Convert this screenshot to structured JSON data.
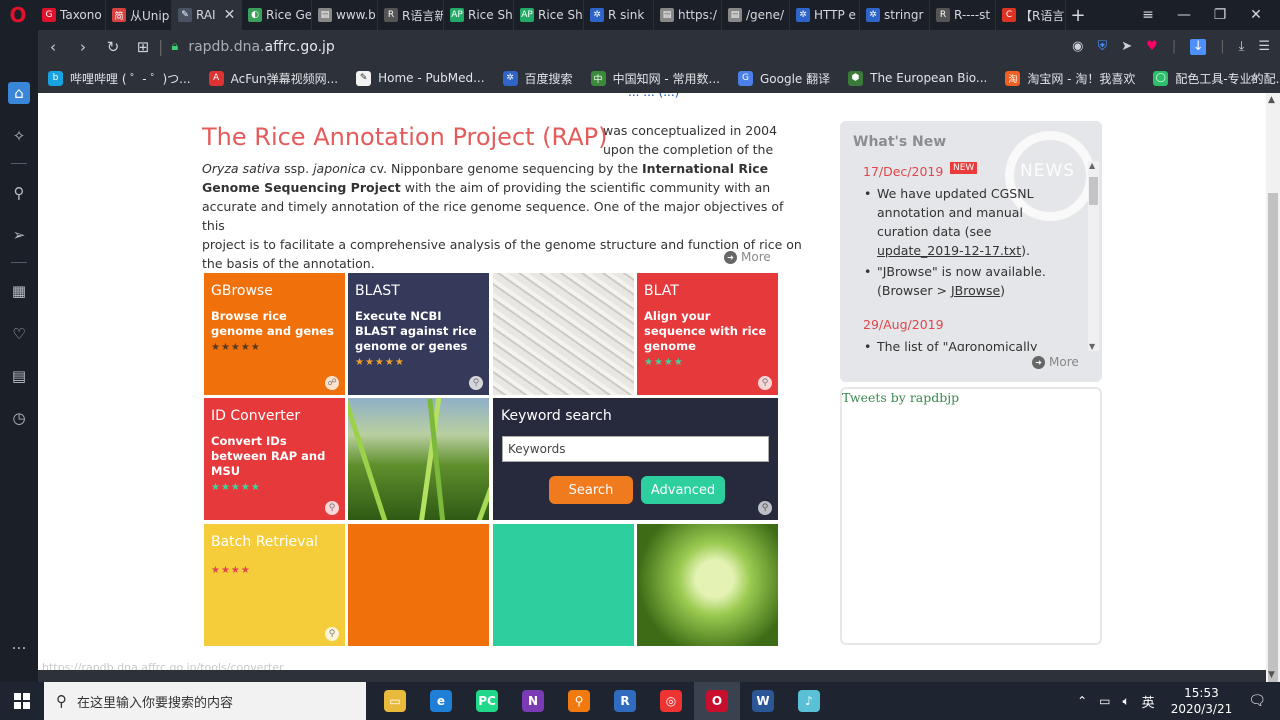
{
  "browser": {
    "tabs": [
      {
        "label": "Taxono",
        "icon": "G",
        "color": "#e0112b"
      },
      {
        "label": "从Unip",
        "icon": "简",
        "color": "#d94040"
      },
      {
        "label": "RAI",
        "icon": "✎",
        "color": "#4a5363",
        "active": true
      },
      {
        "label": "Rice Ge",
        "icon": "◐",
        "color": "#3aa05a"
      },
      {
        "label": "www.b",
        "icon": "▤",
        "color": "#888"
      },
      {
        "label": "R语言新",
        "icon": "R",
        "color": "#555"
      },
      {
        "label": "Rice Sh",
        "icon": "AP",
        "color": "#2a6"
      },
      {
        "label": "Rice Sh",
        "icon": "AP",
        "color": "#2a6"
      },
      {
        "label": "R sink",
        "icon": "✲",
        "color": "#2f64c8"
      },
      {
        "label": "https:/",
        "icon": "▤",
        "color": "#888"
      },
      {
        "label": "/gene/",
        "icon": "▤",
        "color": "#888"
      },
      {
        "label": "HTTP e",
        "icon": "✲",
        "color": "#2f64c8"
      },
      {
        "label": "stringr",
        "icon": "✲",
        "color": "#2f64c8"
      },
      {
        "label": "R----st",
        "icon": "R",
        "color": "#555"
      },
      {
        "label": "【R语言",
        "icon": "C",
        "color": "#d32"
      }
    ],
    "active_close": "✕",
    "new_tab": "+",
    "url_prefix": "rapdb.dna.",
    "url_domain": "affrc.go.jp",
    "bookmarks": [
      {
        "label": "哔哩哔哩 ( ゜- ゜)つ...",
        "color": "#19a2e0",
        "icon": "b"
      },
      {
        "label": "AcFun弹幕视频网...",
        "color": "#d33",
        "icon": "A"
      },
      {
        "label": "Home - PubMed...",
        "color": "#f2f2f2",
        "icon": "✎"
      },
      {
        "label": "百度搜索",
        "color": "#2f64c8",
        "icon": "✲"
      },
      {
        "label": "中国知网 - 常用数...",
        "color": "#3a8a3a",
        "icon": "中"
      },
      {
        "label": "Google 翻译",
        "color": "#4a80e8",
        "icon": "G"
      },
      {
        "label": "The European Bio...",
        "color": "#3a7a3a",
        "icon": "⬢"
      },
      {
        "label": "淘宝网 - 淘！我喜欢",
        "color": "#f06020",
        "icon": "淘"
      },
      {
        "label": "配色工具-专业的配...",
        "color": "#2cbf6a",
        "icon": "◯"
      }
    ]
  },
  "page": {
    "top_cut_text": "... ... (...)",
    "title": "The Rice Annotation Project (RAP)",
    "intro_line1": "was conceptualized in 2004",
    "intro_line2": "upon the completion of the",
    "intro_oryza": "Oryza sativa",
    "intro_ssp": " ssp. ",
    "intro_japonica": "japonica",
    "intro_cv": " cv.  Nipponbare genome sequencing by the ",
    "intro_irgsp1": "International Rice",
    "intro_irgsp2": "Genome Sequencing Project",
    "intro_rest1": " with the aim of providing the scientific community with an",
    "intro_rest2": "accurate and timely annotation of the rice genome sequence. One of the major objectives of this",
    "intro_rest3": "project is to facilitate a comprehensive analysis of the genome structure and function of rice on",
    "intro_rest4": "the basis of the annotation.",
    "more": "More",
    "tiles": {
      "gbrowse": {
        "title": "GBrowse",
        "desc": "Browse rice genome and genes",
        "stars": "★★★★★"
      },
      "blast": {
        "title": "BLAST",
        "desc": "Execute NCBI BLAST against rice genome or genes",
        "stars": "★★★★★"
      },
      "blat": {
        "title": "BLAT",
        "desc": "Align your sequence with rice genome",
        "stars": "★★★★"
      },
      "idconv": {
        "title": "ID Converter",
        "desc": "Convert IDs between RAP and MSU",
        "stars": "★★★★★"
      },
      "batch": {
        "title": "Batch Retrieval",
        "stars": "★★★★"
      }
    },
    "keyword": {
      "title": "Keyword search",
      "value": "Keywords",
      "search_btn": "Search",
      "advanced_btn": "Advanced"
    },
    "news": {
      "heading": "What's New",
      "logo_word": "NEWS",
      "date1": "17/Dec/2019",
      "new_badge": "NEW",
      "item1_a": "We have updated CGSNL annotation and manual curation data (see ",
      "item1_link": "update_2019-12-17.txt",
      "item1_b": ").",
      "item2_a": "\"JBrowse\" is now available. (Browser > ",
      "item2_link": "JBrowse",
      "item2_b": ")",
      "date2": "29/Aug/2019",
      "item3": "The list of \"Agronomically",
      "more": "More"
    },
    "tweets": "Tweets by rapdbjp",
    "status_url": "https://rapdb.dna.affrc.go.jp/tools/converter"
  },
  "taskbar": {
    "search_placeholder": "在这里输入你要搜索的内容",
    "apps": [
      {
        "icon": "▭",
        "color": "#e8b93a"
      },
      {
        "icon": "e",
        "color": "#1f7fd6"
      },
      {
        "icon": "PC",
        "color": "#21d789"
      },
      {
        "icon": "N",
        "color": "#7a3bb5"
      },
      {
        "icon": "⚲",
        "color": "#f07a10"
      },
      {
        "icon": "R",
        "color": "#2f6bbf"
      },
      {
        "icon": "◎",
        "color": "#e33"
      },
      {
        "icon": "O",
        "color": "#c8102e"
      },
      {
        "icon": "W",
        "color": "#2b5797"
      },
      {
        "icon": "♪",
        "color": "#59c0d6"
      }
    ],
    "ime": "英",
    "time": "15:53",
    "date": "2020/3/21"
  }
}
